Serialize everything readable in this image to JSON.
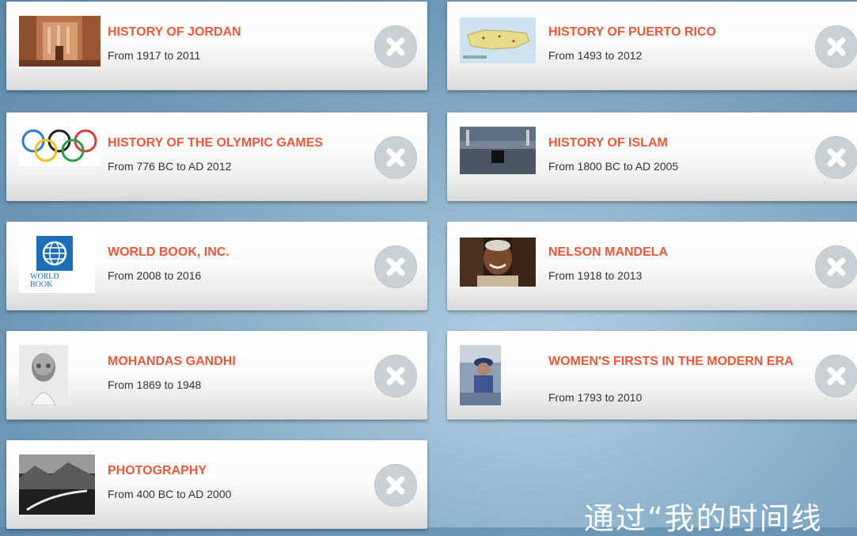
{
  "cards": [
    {
      "title": "HISTORY OF JORDAN",
      "range": "From 1917 to 2011",
      "thumb": "petra-icon"
    },
    {
      "title": "HISTORY OF PUERTO RICO",
      "range": "From 1493 to 2012",
      "thumb": "puerto-rico-map-icon"
    },
    {
      "title": "HISTORY OF THE OLYMPIC GAMES",
      "range": "From 776 BC to AD 2012",
      "thumb": "olympic-rings-icon"
    },
    {
      "title": "HISTORY OF ISLAM",
      "range": "From 1800 BC to AD 2005",
      "thumb": "mecca-icon"
    },
    {
      "title": "WORLD BOOK, INC.",
      "range": "From 2008 to 2016",
      "thumb": "world-book-logo-icon"
    },
    {
      "title": "NELSON MANDELA",
      "range": "From 1918 to 2013",
      "thumb": "mandela-portrait-icon"
    },
    {
      "title": "MOHANDAS GANDHI",
      "range": "From 1869 to 1948",
      "thumb": "gandhi-portrait-icon"
    },
    {
      "title": "WOMEN'S FIRSTS IN THE MODERN ERA",
      "range": "From 1793 to 2010",
      "thumb": "women-firsts-icon"
    },
    {
      "title": "PHOTOGRAPHY",
      "range": "From 400 BC to AD 2000",
      "thumb": "landscape-photo-icon"
    }
  ],
  "logo_text": {
    "line1": "WORLD",
    "line2": "BOOK"
  },
  "caption": "通过“我的时间线",
  "colors": {
    "title": "#e9593a",
    "close_button": "#c9d1d6",
    "close_x": "#ffffff"
  }
}
